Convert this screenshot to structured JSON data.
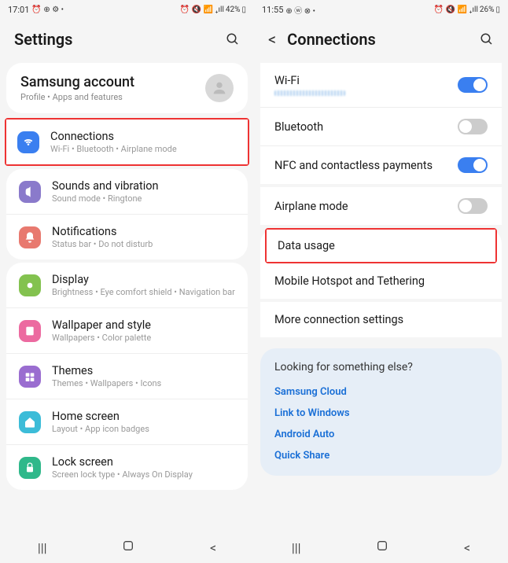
{
  "left": {
    "status": {
      "time": "17:01",
      "battery": "42%"
    },
    "header": "Settings",
    "account": {
      "title": "Samsung account",
      "sub": "Profile  •  Apps and features"
    },
    "groups": [
      [
        {
          "title": "Connections",
          "sub": "Wi-Fi  •  Bluetooth  •  Airplane mode",
          "color": "#3a7ff0",
          "highlight": true
        }
      ],
      [
        {
          "title": "Sounds and vibration",
          "sub": "Sound mode  •  Ringtone",
          "color": "#8a7acb"
        },
        {
          "title": "Notifications",
          "sub": "Status bar  •  Do not disturb",
          "color": "#e8796f"
        }
      ],
      [
        {
          "title": "Display",
          "sub": "Brightness  •  Eye comfort shield  •  Navigation bar",
          "color": "#83c24f"
        },
        {
          "title": "Wallpaper and style",
          "sub": "Wallpapers  •  Color palette",
          "color": "#ec6aa0"
        },
        {
          "title": "Themes",
          "sub": "Themes  •  Wallpapers  •  Icons",
          "color": "#9a6dd0"
        },
        {
          "title": "Home screen",
          "sub": "Layout  •  App icon badges",
          "color": "#3cbcd8"
        },
        {
          "title": "Lock screen",
          "sub": "Screen lock type  •  Always On Display",
          "color": "#2fb88a"
        }
      ]
    ]
  },
  "right": {
    "status": {
      "time": "11:55",
      "battery": "26%"
    },
    "header": "Connections",
    "groups": [
      [
        {
          "title": "Wi-Fi",
          "hasSub": true,
          "toggle": "on"
        },
        {
          "title": "Bluetooth",
          "toggle": "off"
        },
        {
          "title": "NFC and contactless payments",
          "toggle": "on"
        }
      ],
      [
        {
          "title": "Airplane mode",
          "toggle": "off"
        }
      ],
      [
        {
          "title": "Data usage",
          "highlight": true
        },
        {
          "title": "Mobile Hotspot and Tethering"
        }
      ],
      [
        {
          "title": "More connection settings"
        }
      ]
    ],
    "suggest": {
      "title": "Looking for something else?",
      "links": [
        "Samsung Cloud",
        "Link to Windows",
        "Android Auto",
        "Quick Share"
      ]
    }
  }
}
